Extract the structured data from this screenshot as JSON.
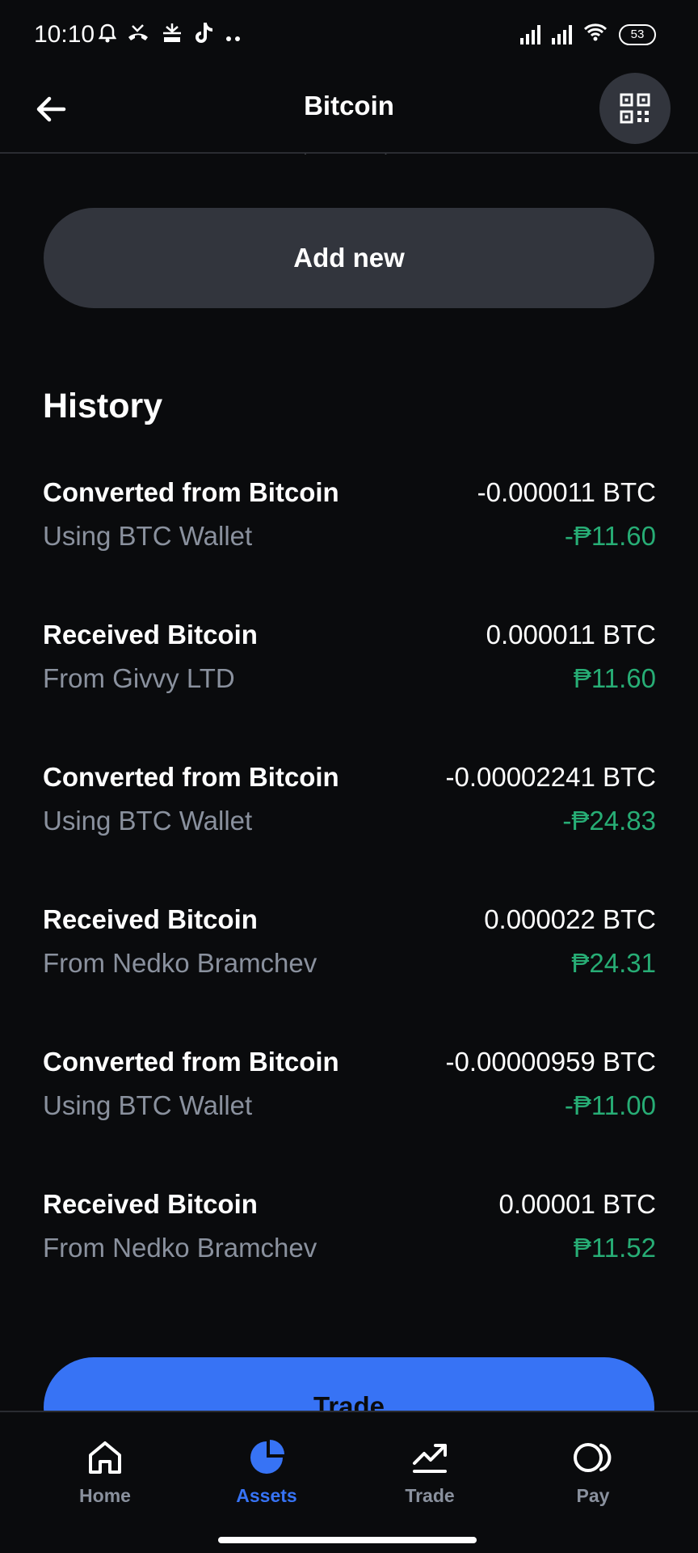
{
  "status_bar": {
    "time": "10:10",
    "battery": "53"
  },
  "header": {
    "title": "Bitcoin"
  },
  "clipped_text": "………,  ………,  ………",
  "add_new_label": "Add new",
  "history": {
    "title": "History",
    "items": [
      {
        "title": "Converted from Bitcoin",
        "subtitle": "Using BTC Wallet",
        "amount": "-0.000011 BTC",
        "fiat": "-₱11.60"
      },
      {
        "title": "Received Bitcoin",
        "subtitle": "From Givvy LTD",
        "amount": "0.000011 BTC",
        "fiat": "₱11.60"
      },
      {
        "title": "Converted from Bitcoin",
        "subtitle": "Using BTC Wallet",
        "amount": "-0.00002241 BTC",
        "fiat": "-₱24.83"
      },
      {
        "title": "Received Bitcoin",
        "subtitle": "From Nedko Bramchev",
        "amount": "0.000022 BTC",
        "fiat": "₱24.31"
      },
      {
        "title": "Converted from Bitcoin",
        "subtitle": "Using BTC Wallet",
        "amount": "-0.00000959 BTC",
        "fiat": "-₱11.00"
      },
      {
        "title": "Received Bitcoin",
        "subtitle": "From Nedko Bramchev",
        "amount": "0.00001 BTC",
        "fiat": "₱11.52"
      }
    ]
  },
  "trade_button_label": "Trade",
  "nav": {
    "items": [
      {
        "label": "Home",
        "icon": "home-icon"
      },
      {
        "label": "Assets",
        "icon": "pie-chart-icon"
      },
      {
        "label": "Trade",
        "icon": "trend-up-icon"
      },
      {
        "label": "Pay",
        "icon": "pay-icon"
      }
    ],
    "active": "Assets"
  },
  "colors": {
    "background": "#0a0b0d",
    "button_gray": "#32353d",
    "accent_blue": "#3773f5",
    "positive_green": "#27ad75",
    "muted_text": "#8a919e"
  }
}
